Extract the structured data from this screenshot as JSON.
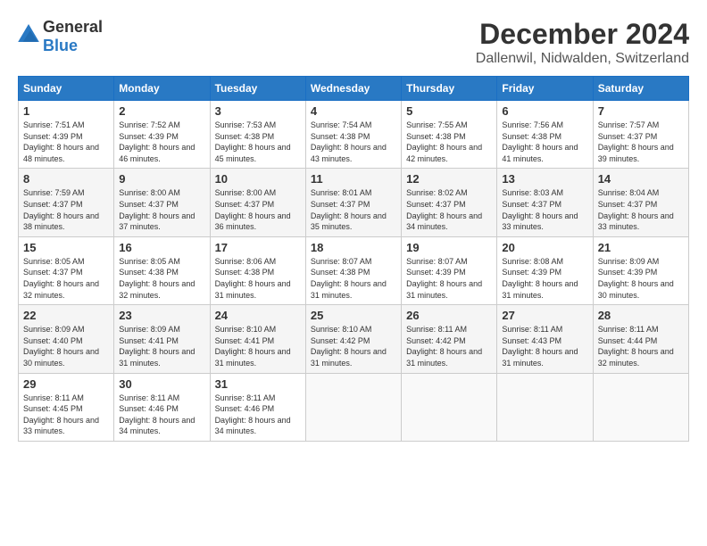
{
  "header": {
    "logo_general": "General",
    "logo_blue": "Blue",
    "month_title": "December 2024",
    "location": "Dallenwil, Nidwalden, Switzerland"
  },
  "weekdays": [
    "Sunday",
    "Monday",
    "Tuesday",
    "Wednesday",
    "Thursday",
    "Friday",
    "Saturday"
  ],
  "weeks": [
    [
      {
        "day": "1",
        "sunrise": "Sunrise: 7:51 AM",
        "sunset": "Sunset: 4:39 PM",
        "daylight": "Daylight: 8 hours and 48 minutes."
      },
      {
        "day": "2",
        "sunrise": "Sunrise: 7:52 AM",
        "sunset": "Sunset: 4:39 PM",
        "daylight": "Daylight: 8 hours and 46 minutes."
      },
      {
        "day": "3",
        "sunrise": "Sunrise: 7:53 AM",
        "sunset": "Sunset: 4:38 PM",
        "daylight": "Daylight: 8 hours and 45 minutes."
      },
      {
        "day": "4",
        "sunrise": "Sunrise: 7:54 AM",
        "sunset": "Sunset: 4:38 PM",
        "daylight": "Daylight: 8 hours and 43 minutes."
      },
      {
        "day": "5",
        "sunrise": "Sunrise: 7:55 AM",
        "sunset": "Sunset: 4:38 PM",
        "daylight": "Daylight: 8 hours and 42 minutes."
      },
      {
        "day": "6",
        "sunrise": "Sunrise: 7:56 AM",
        "sunset": "Sunset: 4:38 PM",
        "daylight": "Daylight: 8 hours and 41 minutes."
      },
      {
        "day": "7",
        "sunrise": "Sunrise: 7:57 AM",
        "sunset": "Sunset: 4:37 PM",
        "daylight": "Daylight: 8 hours and 39 minutes."
      }
    ],
    [
      {
        "day": "8",
        "sunrise": "Sunrise: 7:59 AM",
        "sunset": "Sunset: 4:37 PM",
        "daylight": "Daylight: 8 hours and 38 minutes."
      },
      {
        "day": "9",
        "sunrise": "Sunrise: 8:00 AM",
        "sunset": "Sunset: 4:37 PM",
        "daylight": "Daylight: 8 hours and 37 minutes."
      },
      {
        "day": "10",
        "sunrise": "Sunrise: 8:00 AM",
        "sunset": "Sunset: 4:37 PM",
        "daylight": "Daylight: 8 hours and 36 minutes."
      },
      {
        "day": "11",
        "sunrise": "Sunrise: 8:01 AM",
        "sunset": "Sunset: 4:37 PM",
        "daylight": "Daylight: 8 hours and 35 minutes."
      },
      {
        "day": "12",
        "sunrise": "Sunrise: 8:02 AM",
        "sunset": "Sunset: 4:37 PM",
        "daylight": "Daylight: 8 hours and 34 minutes."
      },
      {
        "day": "13",
        "sunrise": "Sunrise: 8:03 AM",
        "sunset": "Sunset: 4:37 PM",
        "daylight": "Daylight: 8 hours and 33 minutes."
      },
      {
        "day": "14",
        "sunrise": "Sunrise: 8:04 AM",
        "sunset": "Sunset: 4:37 PM",
        "daylight": "Daylight: 8 hours and 33 minutes."
      }
    ],
    [
      {
        "day": "15",
        "sunrise": "Sunrise: 8:05 AM",
        "sunset": "Sunset: 4:37 PM",
        "daylight": "Daylight: 8 hours and 32 minutes."
      },
      {
        "day": "16",
        "sunrise": "Sunrise: 8:05 AM",
        "sunset": "Sunset: 4:38 PM",
        "daylight": "Daylight: 8 hours and 32 minutes."
      },
      {
        "day": "17",
        "sunrise": "Sunrise: 8:06 AM",
        "sunset": "Sunset: 4:38 PM",
        "daylight": "Daylight: 8 hours and 31 minutes."
      },
      {
        "day": "18",
        "sunrise": "Sunrise: 8:07 AM",
        "sunset": "Sunset: 4:38 PM",
        "daylight": "Daylight: 8 hours and 31 minutes."
      },
      {
        "day": "19",
        "sunrise": "Sunrise: 8:07 AM",
        "sunset": "Sunset: 4:39 PM",
        "daylight": "Daylight: 8 hours and 31 minutes."
      },
      {
        "day": "20",
        "sunrise": "Sunrise: 8:08 AM",
        "sunset": "Sunset: 4:39 PM",
        "daylight": "Daylight: 8 hours and 31 minutes."
      },
      {
        "day": "21",
        "sunrise": "Sunrise: 8:09 AM",
        "sunset": "Sunset: 4:39 PM",
        "daylight": "Daylight: 8 hours and 30 minutes."
      }
    ],
    [
      {
        "day": "22",
        "sunrise": "Sunrise: 8:09 AM",
        "sunset": "Sunset: 4:40 PM",
        "daylight": "Daylight: 8 hours and 30 minutes."
      },
      {
        "day": "23",
        "sunrise": "Sunrise: 8:09 AM",
        "sunset": "Sunset: 4:41 PM",
        "daylight": "Daylight: 8 hours and 31 minutes."
      },
      {
        "day": "24",
        "sunrise": "Sunrise: 8:10 AM",
        "sunset": "Sunset: 4:41 PM",
        "daylight": "Daylight: 8 hours and 31 minutes."
      },
      {
        "day": "25",
        "sunrise": "Sunrise: 8:10 AM",
        "sunset": "Sunset: 4:42 PM",
        "daylight": "Daylight: 8 hours and 31 minutes."
      },
      {
        "day": "26",
        "sunrise": "Sunrise: 8:11 AM",
        "sunset": "Sunset: 4:42 PM",
        "daylight": "Daylight: 8 hours and 31 minutes."
      },
      {
        "day": "27",
        "sunrise": "Sunrise: 8:11 AM",
        "sunset": "Sunset: 4:43 PM",
        "daylight": "Daylight: 8 hours and 31 minutes."
      },
      {
        "day": "28",
        "sunrise": "Sunrise: 8:11 AM",
        "sunset": "Sunset: 4:44 PM",
        "daylight": "Daylight: 8 hours and 32 minutes."
      }
    ],
    [
      {
        "day": "29",
        "sunrise": "Sunrise: 8:11 AM",
        "sunset": "Sunset: 4:45 PM",
        "daylight": "Daylight: 8 hours and 33 minutes."
      },
      {
        "day": "30",
        "sunrise": "Sunrise: 8:11 AM",
        "sunset": "Sunset: 4:46 PM",
        "daylight": "Daylight: 8 hours and 34 minutes."
      },
      {
        "day": "31",
        "sunrise": "Sunrise: 8:11 AM",
        "sunset": "Sunset: 4:46 PM",
        "daylight": "Daylight: 8 hours and 34 minutes."
      },
      null,
      null,
      null,
      null
    ]
  ]
}
